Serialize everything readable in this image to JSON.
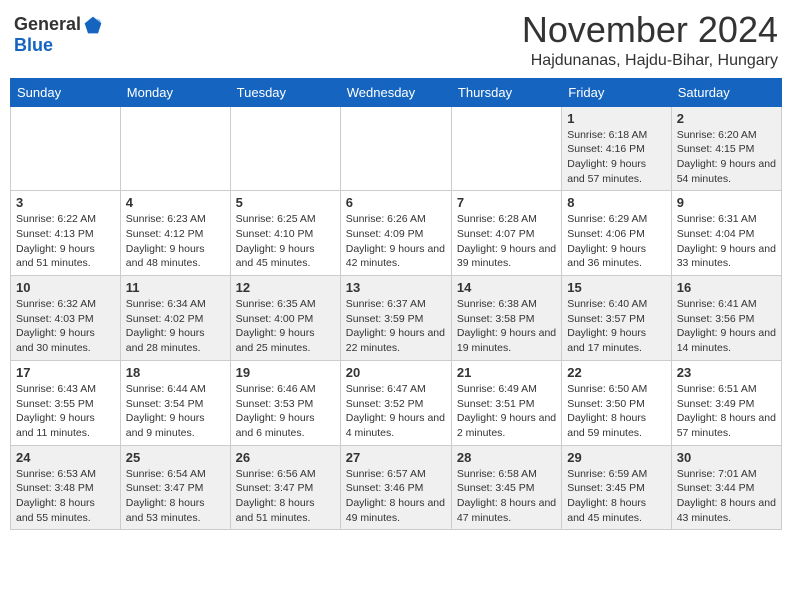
{
  "header": {
    "logo_general": "General",
    "logo_blue": "Blue",
    "month": "November 2024",
    "location": "Hajdunanas, Hajdu-Bihar, Hungary"
  },
  "weekdays": [
    "Sunday",
    "Monday",
    "Tuesday",
    "Wednesday",
    "Thursday",
    "Friday",
    "Saturday"
  ],
  "weeks": [
    [
      {
        "day": "",
        "info": ""
      },
      {
        "day": "",
        "info": ""
      },
      {
        "day": "",
        "info": ""
      },
      {
        "day": "",
        "info": ""
      },
      {
        "day": "",
        "info": ""
      },
      {
        "day": "1",
        "info": "Sunrise: 6:18 AM\nSunset: 4:16 PM\nDaylight: 9 hours\nand 57 minutes."
      },
      {
        "day": "2",
        "info": "Sunrise: 6:20 AM\nSunset: 4:15 PM\nDaylight: 9 hours\nand 54 minutes."
      }
    ],
    [
      {
        "day": "3",
        "info": "Sunrise: 6:22 AM\nSunset: 4:13 PM\nDaylight: 9 hours\nand 51 minutes."
      },
      {
        "day": "4",
        "info": "Sunrise: 6:23 AM\nSunset: 4:12 PM\nDaylight: 9 hours\nand 48 minutes."
      },
      {
        "day": "5",
        "info": "Sunrise: 6:25 AM\nSunset: 4:10 PM\nDaylight: 9 hours\nand 45 minutes."
      },
      {
        "day": "6",
        "info": "Sunrise: 6:26 AM\nSunset: 4:09 PM\nDaylight: 9 hours\nand 42 minutes."
      },
      {
        "day": "7",
        "info": "Sunrise: 6:28 AM\nSunset: 4:07 PM\nDaylight: 9 hours\nand 39 minutes."
      },
      {
        "day": "8",
        "info": "Sunrise: 6:29 AM\nSunset: 4:06 PM\nDaylight: 9 hours\nand 36 minutes."
      },
      {
        "day": "9",
        "info": "Sunrise: 6:31 AM\nSunset: 4:04 PM\nDaylight: 9 hours\nand 33 minutes."
      }
    ],
    [
      {
        "day": "10",
        "info": "Sunrise: 6:32 AM\nSunset: 4:03 PM\nDaylight: 9 hours\nand 30 minutes."
      },
      {
        "day": "11",
        "info": "Sunrise: 6:34 AM\nSunset: 4:02 PM\nDaylight: 9 hours\nand 28 minutes."
      },
      {
        "day": "12",
        "info": "Sunrise: 6:35 AM\nSunset: 4:00 PM\nDaylight: 9 hours\nand 25 minutes."
      },
      {
        "day": "13",
        "info": "Sunrise: 6:37 AM\nSunset: 3:59 PM\nDaylight: 9 hours\nand 22 minutes."
      },
      {
        "day": "14",
        "info": "Sunrise: 6:38 AM\nSunset: 3:58 PM\nDaylight: 9 hours\nand 19 minutes."
      },
      {
        "day": "15",
        "info": "Sunrise: 6:40 AM\nSunset: 3:57 PM\nDaylight: 9 hours\nand 17 minutes."
      },
      {
        "day": "16",
        "info": "Sunrise: 6:41 AM\nSunset: 3:56 PM\nDaylight: 9 hours\nand 14 minutes."
      }
    ],
    [
      {
        "day": "17",
        "info": "Sunrise: 6:43 AM\nSunset: 3:55 PM\nDaylight: 9 hours\nand 11 minutes."
      },
      {
        "day": "18",
        "info": "Sunrise: 6:44 AM\nSunset: 3:54 PM\nDaylight: 9 hours\nand 9 minutes."
      },
      {
        "day": "19",
        "info": "Sunrise: 6:46 AM\nSunset: 3:53 PM\nDaylight: 9 hours\nand 6 minutes."
      },
      {
        "day": "20",
        "info": "Sunrise: 6:47 AM\nSunset: 3:52 PM\nDaylight: 9 hours\nand 4 minutes."
      },
      {
        "day": "21",
        "info": "Sunrise: 6:49 AM\nSunset: 3:51 PM\nDaylight: 9 hours\nand 2 minutes."
      },
      {
        "day": "22",
        "info": "Sunrise: 6:50 AM\nSunset: 3:50 PM\nDaylight: 8 hours\nand 59 minutes."
      },
      {
        "day": "23",
        "info": "Sunrise: 6:51 AM\nSunset: 3:49 PM\nDaylight: 8 hours\nand 57 minutes."
      }
    ],
    [
      {
        "day": "24",
        "info": "Sunrise: 6:53 AM\nSunset: 3:48 PM\nDaylight: 8 hours\nand 55 minutes."
      },
      {
        "day": "25",
        "info": "Sunrise: 6:54 AM\nSunset: 3:47 PM\nDaylight: 8 hours\nand 53 minutes."
      },
      {
        "day": "26",
        "info": "Sunrise: 6:56 AM\nSunset: 3:47 PM\nDaylight: 8 hours\nand 51 minutes."
      },
      {
        "day": "27",
        "info": "Sunrise: 6:57 AM\nSunset: 3:46 PM\nDaylight: 8 hours\nand 49 minutes."
      },
      {
        "day": "28",
        "info": "Sunrise: 6:58 AM\nSunset: 3:45 PM\nDaylight: 8 hours\nand 47 minutes."
      },
      {
        "day": "29",
        "info": "Sunrise: 6:59 AM\nSunset: 3:45 PM\nDaylight: 8 hours\nand 45 minutes."
      },
      {
        "day": "30",
        "info": "Sunrise: 7:01 AM\nSunset: 3:44 PM\nDaylight: 8 hours\nand 43 minutes."
      }
    ]
  ]
}
